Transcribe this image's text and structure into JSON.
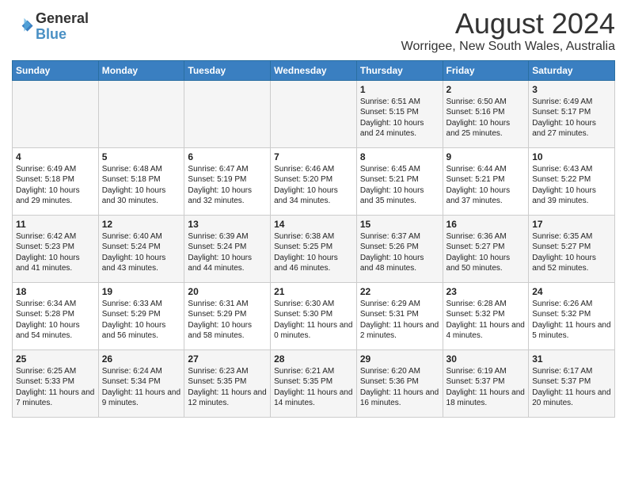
{
  "logo": {
    "line1": "General",
    "line2": "Blue"
  },
  "title": "August 2024",
  "subtitle": "Worrigee, New South Wales, Australia",
  "days_of_week": [
    "Sunday",
    "Monday",
    "Tuesday",
    "Wednesday",
    "Thursday",
    "Friday",
    "Saturday"
  ],
  "weeks": [
    [
      {
        "day": "",
        "info": ""
      },
      {
        "day": "",
        "info": ""
      },
      {
        "day": "",
        "info": ""
      },
      {
        "day": "",
        "info": ""
      },
      {
        "day": "1",
        "info": "Sunrise: 6:51 AM\nSunset: 5:15 PM\nDaylight: 10 hours and 24 minutes."
      },
      {
        "day": "2",
        "info": "Sunrise: 6:50 AM\nSunset: 5:16 PM\nDaylight: 10 hours and 25 minutes."
      },
      {
        "day": "3",
        "info": "Sunrise: 6:49 AM\nSunset: 5:17 PM\nDaylight: 10 hours and 27 minutes."
      }
    ],
    [
      {
        "day": "4",
        "info": "Sunrise: 6:49 AM\nSunset: 5:18 PM\nDaylight: 10 hours and 29 minutes."
      },
      {
        "day": "5",
        "info": "Sunrise: 6:48 AM\nSunset: 5:18 PM\nDaylight: 10 hours and 30 minutes."
      },
      {
        "day": "6",
        "info": "Sunrise: 6:47 AM\nSunset: 5:19 PM\nDaylight: 10 hours and 32 minutes."
      },
      {
        "day": "7",
        "info": "Sunrise: 6:46 AM\nSunset: 5:20 PM\nDaylight: 10 hours and 34 minutes."
      },
      {
        "day": "8",
        "info": "Sunrise: 6:45 AM\nSunset: 5:21 PM\nDaylight: 10 hours and 35 minutes."
      },
      {
        "day": "9",
        "info": "Sunrise: 6:44 AM\nSunset: 5:21 PM\nDaylight: 10 hours and 37 minutes."
      },
      {
        "day": "10",
        "info": "Sunrise: 6:43 AM\nSunset: 5:22 PM\nDaylight: 10 hours and 39 minutes."
      }
    ],
    [
      {
        "day": "11",
        "info": "Sunrise: 6:42 AM\nSunset: 5:23 PM\nDaylight: 10 hours and 41 minutes."
      },
      {
        "day": "12",
        "info": "Sunrise: 6:40 AM\nSunset: 5:24 PM\nDaylight: 10 hours and 43 minutes."
      },
      {
        "day": "13",
        "info": "Sunrise: 6:39 AM\nSunset: 5:24 PM\nDaylight: 10 hours and 44 minutes."
      },
      {
        "day": "14",
        "info": "Sunrise: 6:38 AM\nSunset: 5:25 PM\nDaylight: 10 hours and 46 minutes."
      },
      {
        "day": "15",
        "info": "Sunrise: 6:37 AM\nSunset: 5:26 PM\nDaylight: 10 hours and 48 minutes."
      },
      {
        "day": "16",
        "info": "Sunrise: 6:36 AM\nSunset: 5:27 PM\nDaylight: 10 hours and 50 minutes."
      },
      {
        "day": "17",
        "info": "Sunrise: 6:35 AM\nSunset: 5:27 PM\nDaylight: 10 hours and 52 minutes."
      }
    ],
    [
      {
        "day": "18",
        "info": "Sunrise: 6:34 AM\nSunset: 5:28 PM\nDaylight: 10 hours and 54 minutes."
      },
      {
        "day": "19",
        "info": "Sunrise: 6:33 AM\nSunset: 5:29 PM\nDaylight: 10 hours and 56 minutes."
      },
      {
        "day": "20",
        "info": "Sunrise: 6:31 AM\nSunset: 5:29 PM\nDaylight: 10 hours and 58 minutes."
      },
      {
        "day": "21",
        "info": "Sunrise: 6:30 AM\nSunset: 5:30 PM\nDaylight: 11 hours and 0 minutes."
      },
      {
        "day": "22",
        "info": "Sunrise: 6:29 AM\nSunset: 5:31 PM\nDaylight: 11 hours and 2 minutes."
      },
      {
        "day": "23",
        "info": "Sunrise: 6:28 AM\nSunset: 5:32 PM\nDaylight: 11 hours and 4 minutes."
      },
      {
        "day": "24",
        "info": "Sunrise: 6:26 AM\nSunset: 5:32 PM\nDaylight: 11 hours and 5 minutes."
      }
    ],
    [
      {
        "day": "25",
        "info": "Sunrise: 6:25 AM\nSunset: 5:33 PM\nDaylight: 11 hours and 7 minutes."
      },
      {
        "day": "26",
        "info": "Sunrise: 6:24 AM\nSunset: 5:34 PM\nDaylight: 11 hours and 9 minutes."
      },
      {
        "day": "27",
        "info": "Sunrise: 6:23 AM\nSunset: 5:35 PM\nDaylight: 11 hours and 12 minutes."
      },
      {
        "day": "28",
        "info": "Sunrise: 6:21 AM\nSunset: 5:35 PM\nDaylight: 11 hours and 14 minutes."
      },
      {
        "day": "29",
        "info": "Sunrise: 6:20 AM\nSunset: 5:36 PM\nDaylight: 11 hours and 16 minutes."
      },
      {
        "day": "30",
        "info": "Sunrise: 6:19 AM\nSunset: 5:37 PM\nDaylight: 11 hours and 18 minutes."
      },
      {
        "day": "31",
        "info": "Sunrise: 6:17 AM\nSunset: 5:37 PM\nDaylight: 11 hours and 20 minutes."
      }
    ]
  ]
}
